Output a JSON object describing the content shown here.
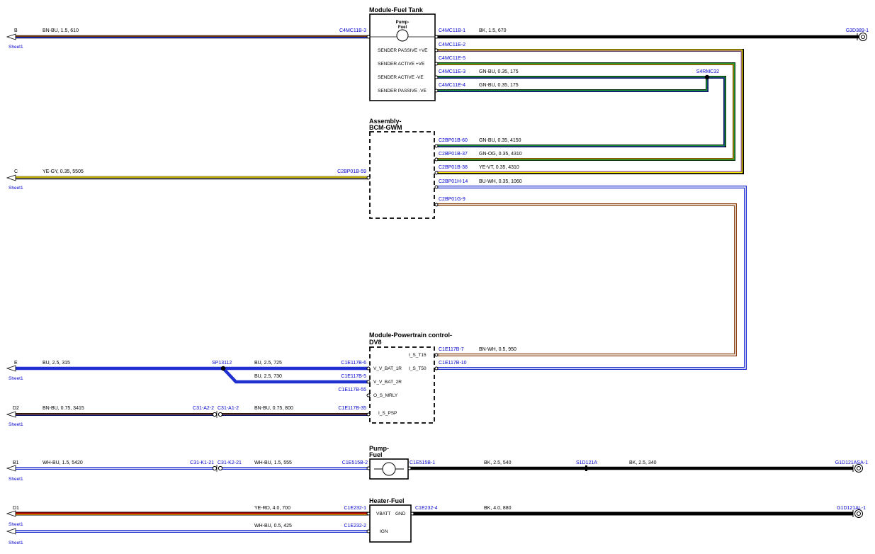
{
  "colors": {
    "BN": "#8b4513",
    "BU": "#1f2fd0",
    "BK": "#000000",
    "YE": "#ffe600",
    "GY": "#9a9a9a",
    "GN": "#1a9b2f",
    "OG": "#ff8c00",
    "VT": "#b06ad0",
    "WH": "#ffffff",
    "RD": "#e00000",
    "connector": "#0000cc"
  },
  "components": {
    "fuel_tank_module": {
      "title": "Module-Fuel Tank",
      "pump_label_1": "Pump-",
      "pump_label_2": "Fuel",
      "pins": [
        "SENDER PASSIVE +VE",
        "SENDER ACTIVE +VE",
        "SENDER ACTIVE -VE",
        "SENDER PASSIVE -VE"
      ]
    },
    "bcm": {
      "title_1": "Assembly-",
      "title_2": "BCM-GWM"
    },
    "pcm": {
      "title_1": "Module-Powertrain control-",
      "title_2": "DV8",
      "pins_left": [
        "V_V_BAT_1R",
        "V_V_BAT_2R",
        "O_S_MRLY",
        "I_S_PSP"
      ],
      "pins_right": [
        "I_S_T15",
        "I_S_T50"
      ]
    },
    "fuel_pump": {
      "title_1": "Pump-",
      "title_2": "Fuel"
    },
    "fuel_heater": {
      "title": "Heater-Fuel",
      "pins": [
        "VBATT",
        "GND",
        "IGN"
      ]
    }
  },
  "sheet_refs": {
    "B": "B",
    "C": "C",
    "E": "E",
    "D2": "D2",
    "B1": "B1",
    "D1": "D1",
    "sheet_label": "Sheet1"
  },
  "connectors": {
    "c4mc11b_3": "C4MC11B-3",
    "c4mc11b_1": "C4MC11B-1",
    "g3d389_1": "G3D389-1",
    "c4mc11e_2": "C4MC11E-2",
    "c4mc11e_5": "C4MC11E-5",
    "c4mc11e_3": "C4MC11E-3",
    "c4mc11e_4": "C4MC11E-4",
    "s4rmc32": "S4RMC32",
    "c2bp01b_60": "C2BP01B-60",
    "c2bp01b_37": "C2BP01B-37",
    "c2bp01b_38": "C2BP01B-38",
    "c2bp01h_14": "C2BP01H-14",
    "c2bp01g_9": "C2BP01G-9",
    "c2bp01b_59": "C2BP01B-59",
    "c1e117b_7": "C1E117B-7",
    "c1e117b_10": "C1E117B-10",
    "c1e117b_6": "C1E117B-6",
    "c1e117b_5": "C1E117B-5",
    "c1e117b_55": "C1E117B-55",
    "c1e117b_35": "C1E117B-35",
    "sp13112": "SP13112",
    "c31_a2_2": "C31-A2-2",
    "c31_a1_2": "C31-A1-2",
    "c31_k1_21": "C31-K1-21",
    "c31_k2_21": "C31-K2-21",
    "c1e515b_2": "C1E515B-2",
    "c1e515b_1": "C1E515B-1",
    "s1d121a": "S1D121A",
    "g1d121asa_1": "G1D121ASA-1",
    "c1e232_1": "C1E232-1",
    "c1e232_2": "C1E232-2",
    "c1e232_4": "C1E232-4",
    "g1d121al_1": "G1D121AL-1"
  },
  "wires": {
    "w_b": "BN-BU,  1.5,  610",
    "w_bk670": "BK,  1.5,  670",
    "w_gnbu175a": "GN-BU,  0.35,  175",
    "w_gnbu175b": "GN-BU,  0.35,  175",
    "w_gnbu4150": "GN-BU,  0.35,  4150",
    "w_gnog4310": "GN-OG,  0.35,  4310",
    "w_yevt4310": "YE-VT,  0.35,  4310",
    "w_buwh1060": "BU-WH,  0.35,  1060",
    "w_yegy5505": "YE-GY,  0.35,  5505",
    "w_bnwh950": "BN-WH,  0.5,  950",
    "w_bu315": "BU,  2.5,  315",
    "w_bu725": "BU,  2.5,  725",
    "w_bu730": "BU,  2.5,  730",
    "w_bnbu3415": "BN-BU,  0.75,  3415",
    "w_bnbu800": "BN-BU,  0.75,  800",
    "w_whbu5420": "WH-BU,  1.5,  5420",
    "w_whbu555": "WH-BU,  1.5,  555",
    "w_bk540": "BK,  2.5,  540",
    "w_bk340": "BK,  2.5,  340",
    "w_yerd700": "YE-RD,  4.0,  700",
    "w_whbu425": "WH-BU,  0.5,  425",
    "w_bk880": "BK,  4.0,  880"
  }
}
